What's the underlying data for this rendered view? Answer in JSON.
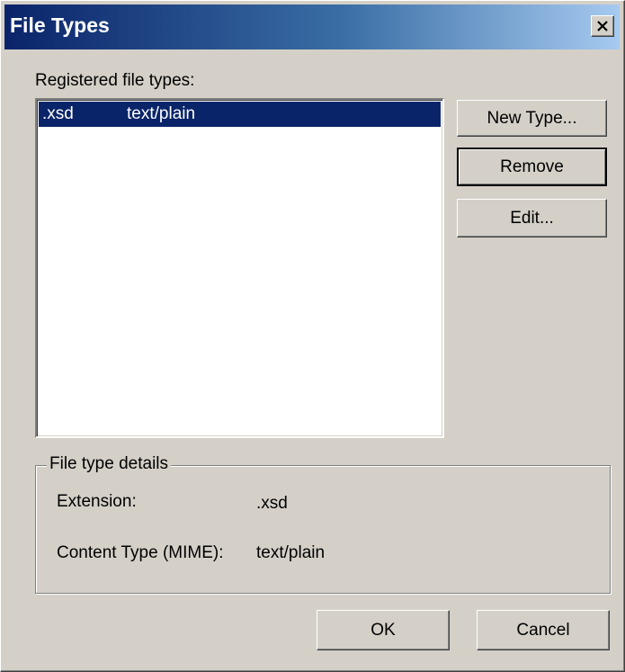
{
  "window": {
    "title": "File Types",
    "close_icon": "close-icon"
  },
  "registered": {
    "label": "Registered file types:",
    "rows": [
      {
        "extension": ".xsd",
        "mime": "text/plain",
        "selected": true
      }
    ]
  },
  "buttons": {
    "new_type": "New Type...",
    "remove": "Remove",
    "edit": "Edit...",
    "ok": "OK",
    "cancel": "Cancel"
  },
  "details": {
    "title": "File type details",
    "extension_label": "Extension:",
    "extension_value": ".xsd",
    "content_type_label": "Content Type (MIME):",
    "content_type_value": "text/plain"
  },
  "colors": {
    "dialog_bg": "#d4d0c8",
    "title_gradient_start": "#0a246a",
    "title_gradient_end": "#a6caf0",
    "selection": "#0a246a"
  }
}
